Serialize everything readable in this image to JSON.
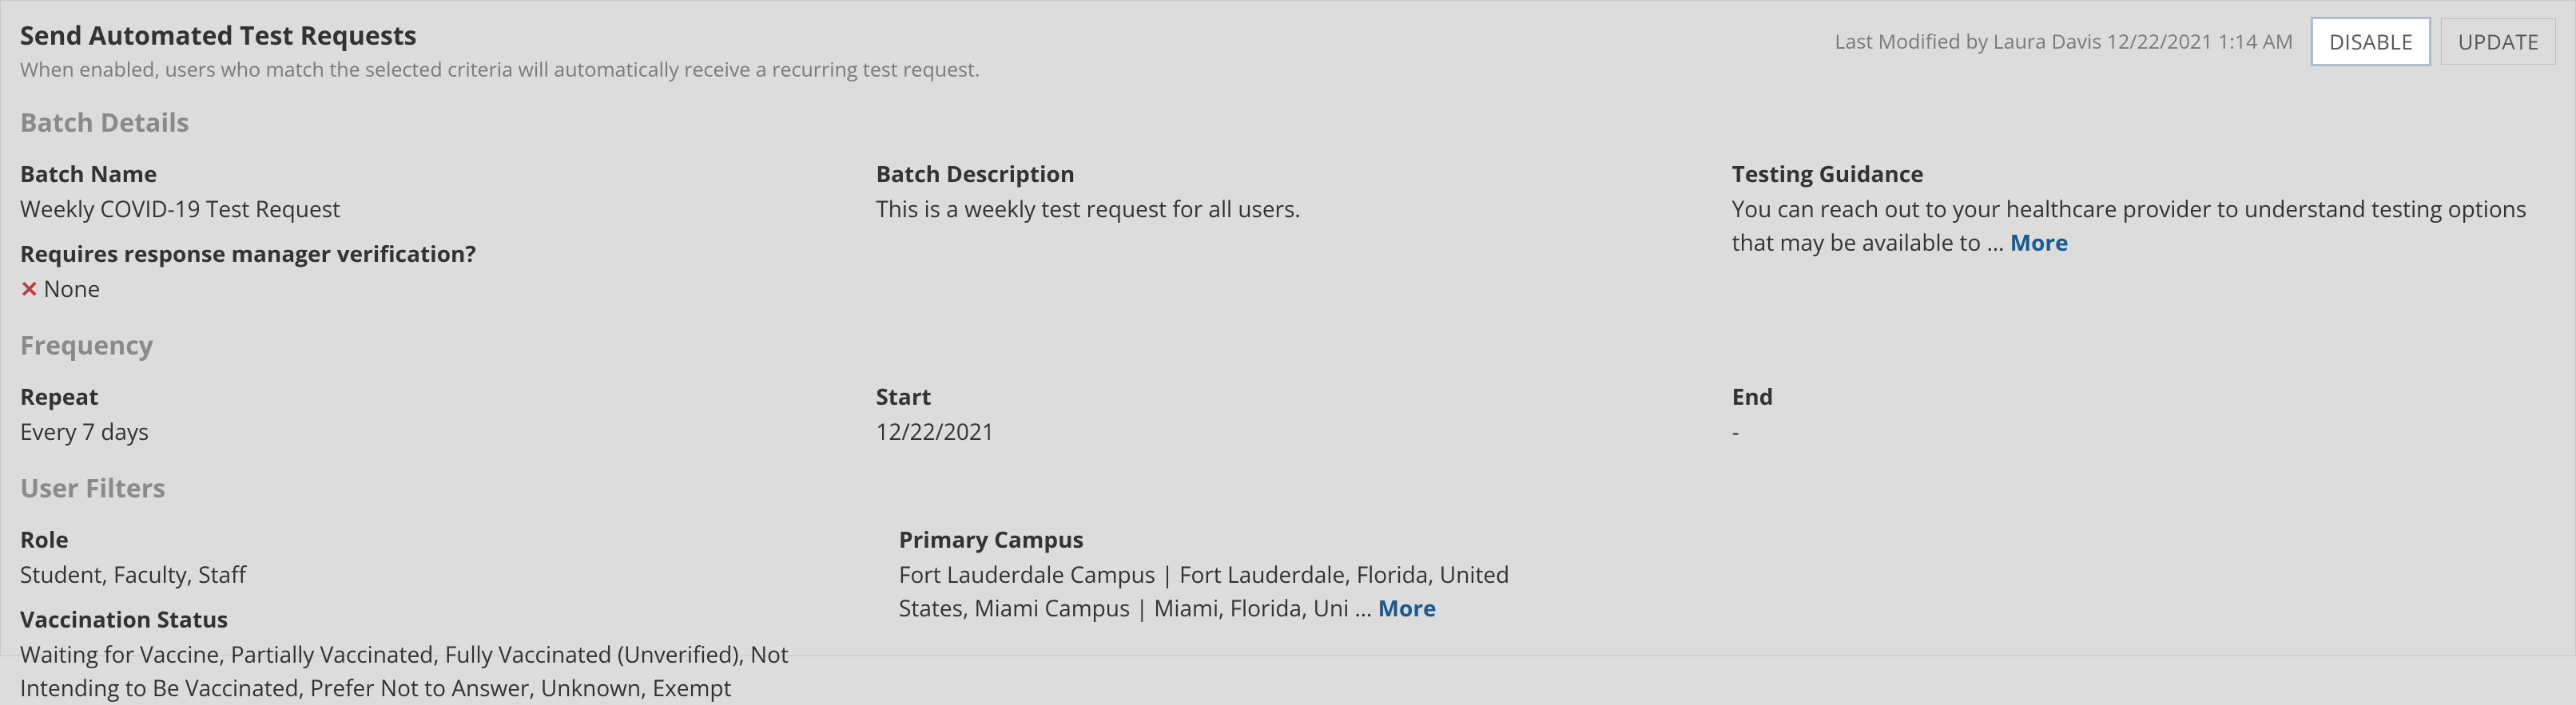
{
  "header": {
    "title": "Send Automated Test Requests",
    "subtitle": "When enabled, users who match the selected criteria will automatically receive a recurring test request.",
    "lastModified": "Last Modified by Laura Davis 12/22/2021 1:14 AM",
    "disableLabel": "DISABLE",
    "updateLabel": "UPDATE"
  },
  "sections": {
    "batchDetails": {
      "title": "Batch Details",
      "batchName": {
        "label": "Batch Name",
        "value": "Weekly COVID-19 Test Request"
      },
      "batchDescription": {
        "label": "Batch Description",
        "value": "This is a weekly test request for all users."
      },
      "testingGuidance": {
        "label": "Testing Guidance",
        "value": "You can reach out to your healthcare provider to understand testing options that may be available to … ",
        "more": "More"
      },
      "requiresVerification": {
        "label": "Requires response manager verification?",
        "value": "None"
      }
    },
    "frequency": {
      "title": "Frequency",
      "repeat": {
        "label": "Repeat",
        "value": "Every 7 days"
      },
      "start": {
        "label": "Start",
        "value": "12/22/2021"
      },
      "end": {
        "label": "End",
        "value": "-"
      }
    },
    "userFilters": {
      "title": "User Filters",
      "role": {
        "label": "Role",
        "value": "Student, Faculty, Staff"
      },
      "primaryCampus": {
        "label": "Primary Campus",
        "value": "Fort Lauderdale Campus | Fort Lauderdale, Florida, United States, Miami Campus | Miami, Florida, Uni … ",
        "more": "More"
      },
      "vaccinationStatus": {
        "label": "Vaccination Status",
        "value": "Waiting for Vaccine, Partially Vaccinated, Fully Vaccinated (Unverified), Not Intending to Be Vaccinated, Prefer Not to Answer, Unknown, Exempt"
      }
    }
  }
}
